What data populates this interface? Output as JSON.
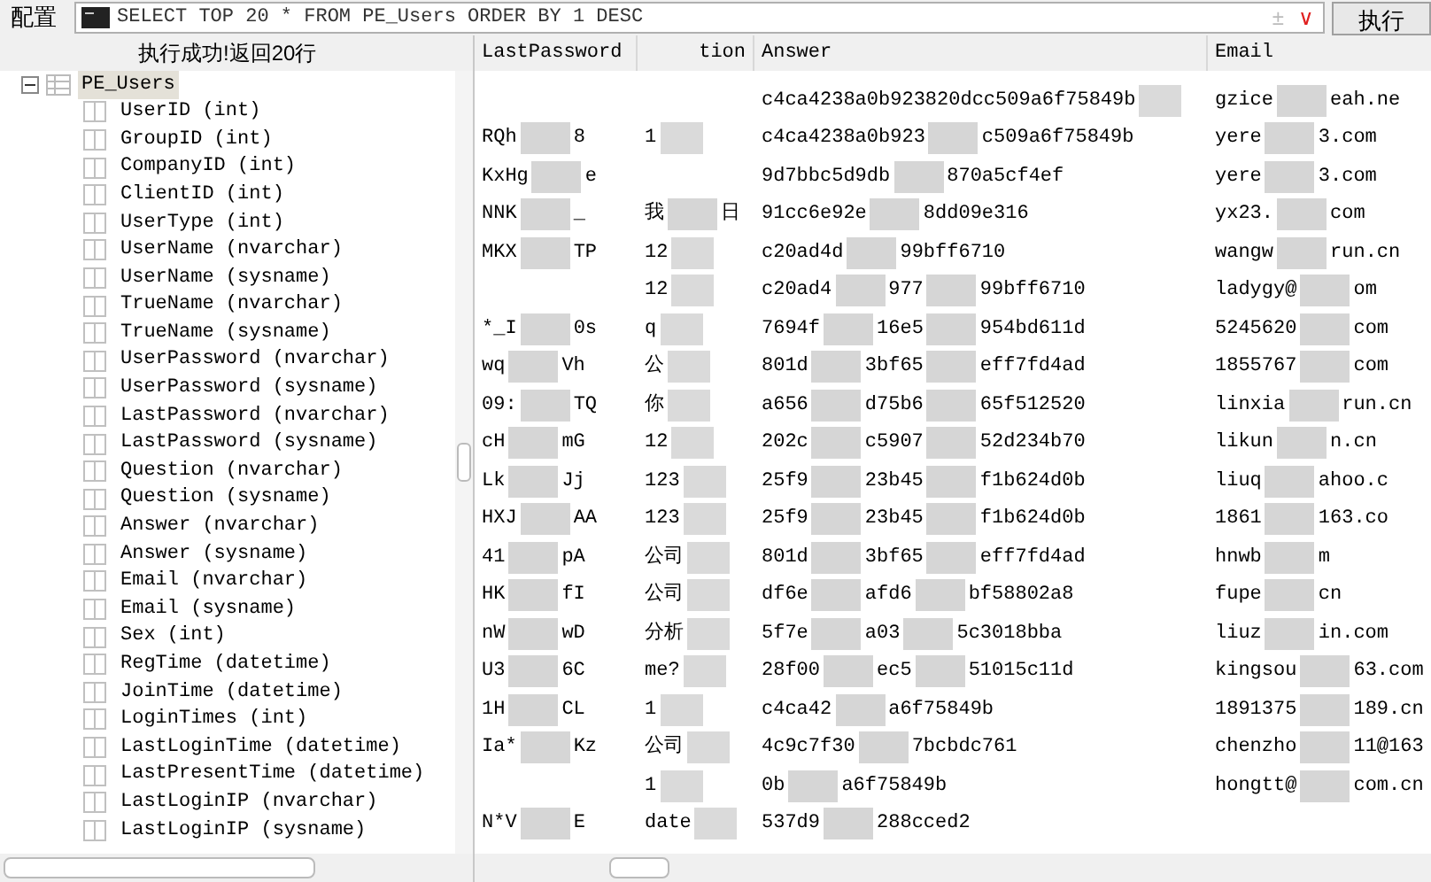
{
  "toolbar": {
    "config_label": "配置",
    "sql": "SELECT TOP 20 * FROM PE_Users ORDER BY 1 DESC",
    "plus_minus": "±",
    "dropdown": "∨",
    "execute": "执行"
  },
  "status": "执行成功!返回20行",
  "tree": {
    "table": "PE_Users",
    "selected": true,
    "expanded": true,
    "children": [
      {
        "label": "UserID (int)"
      },
      {
        "label": "GroupID (int)"
      },
      {
        "label": "CompanyID (int)"
      },
      {
        "label": "ClientID (int)"
      },
      {
        "label": "UserType (int)"
      },
      {
        "label": "UserName (nvarchar)"
      },
      {
        "label": "UserName (sysname)"
      },
      {
        "label": "TrueName (nvarchar)"
      },
      {
        "label": "TrueName (sysname)"
      },
      {
        "label": "UserPassword (nvarchar)"
      },
      {
        "label": "UserPassword (sysname)"
      },
      {
        "label": "LastPassword (nvarchar)"
      },
      {
        "label": "LastPassword (sysname)"
      },
      {
        "label": "Question (nvarchar)"
      },
      {
        "label": "Question (sysname)"
      },
      {
        "label": "Answer (nvarchar)"
      },
      {
        "label": "Answer (sysname)"
      },
      {
        "label": "Email (nvarchar)"
      },
      {
        "label": "Email (sysname)"
      },
      {
        "label": "Sex (int)"
      },
      {
        "label": "RegTime (datetime)"
      },
      {
        "label": "JoinTime (datetime)"
      },
      {
        "label": "LoginTimes (int)"
      },
      {
        "label": "LastLoginTime (datetime)"
      },
      {
        "label": "LastPresentTime (datetime)"
      },
      {
        "label": "LastLoginIP (nvarchar)"
      },
      {
        "label": "LastLoginIP (sysname)"
      }
    ]
  },
  "table": {
    "columns": [
      "LastPassword",
      "tion",
      "Answer",
      "Email"
    ],
    "rows": [
      [
        [],
        [],
        [
          "c4ca4238a0b923820dcc509a6f75849b"
        ],
        [
          "gzice",
          "eah.ne"
        ]
      ],
      [
        [
          "RQh",
          "8"
        ],
        [
          "1"
        ],
        [
          "c4ca4238a0b923",
          "c509a6f75849b"
        ],
        [
          "yere",
          "3.com"
        ]
      ],
      [
        [
          "KxHg",
          "e"
        ],
        [],
        [
          "9d7bbc5d9db",
          "870a5cf4ef"
        ],
        [
          "yere",
          "3.com"
        ]
      ],
      [
        [
          "NNK",
          "_"
        ],
        [
          "我",
          "日"
        ],
        [
          "91cc6e92e",
          "8dd09e316"
        ],
        [
          "yx23.",
          "com"
        ]
      ],
      [
        [
          "MKX",
          "TP"
        ],
        [
          "12"
        ],
        [
          "c20ad4d",
          "99bff6710"
        ],
        [
          "wangw",
          "run.cn"
        ]
      ],
      [
        [],
        [
          "12"
        ],
        [
          "c20ad4",
          "977",
          "99bff6710"
        ],
        [
          "ladygy@",
          "om"
        ]
      ],
      [
        [
          "*_I",
          "0s"
        ],
        [
          "q"
        ],
        [
          "7694f",
          "16e5",
          "954bd611d"
        ],
        [
          "5245620",
          "com"
        ]
      ],
      [
        [
          "wq",
          "Vh"
        ],
        [
          "公"
        ],
        [
          "801d",
          "3bf65",
          "eff7fd4ad"
        ],
        [
          "1855767",
          "com"
        ]
      ],
      [
        [
          "09:",
          "TQ"
        ],
        [
          "你"
        ],
        [
          "a656",
          "d75b6",
          "65f512520"
        ],
        [
          "linxia",
          "run.cn"
        ]
      ],
      [
        [
          "cH",
          "mG"
        ],
        [
          "12"
        ],
        [
          "202c",
          "c5907",
          "52d234b70"
        ],
        [
          "likun",
          "n.cn"
        ]
      ],
      [
        [
          "Lk",
          "Jj"
        ],
        [
          "123"
        ],
        [
          "25f9",
          "23b45",
          "f1b624d0b"
        ],
        [
          "liuq",
          "ahoo.c"
        ]
      ],
      [
        [
          "HXJ",
          "AA"
        ],
        [
          "123"
        ],
        [
          "25f9",
          "23b45",
          "f1b624d0b"
        ],
        [
          "1861",
          "163.co"
        ]
      ],
      [
        [
          "41",
          "pA"
        ],
        [
          "公司"
        ],
        [
          "801d",
          "3bf65",
          "eff7fd4ad"
        ],
        [
          "hnwb",
          "m"
        ]
      ],
      [
        [
          "HK",
          "fI"
        ],
        [
          "公司"
        ],
        [
          "df6e",
          "afd6",
          "bf58802a8"
        ],
        [
          "fupe",
          "cn"
        ]
      ],
      [
        [
          "nW",
          "wD"
        ],
        [
          "分析"
        ],
        [
          "5f7e",
          "a03",
          "5c3018bba"
        ],
        [
          "liuz",
          "in.com"
        ]
      ],
      [
        [
          "U3",
          "6C"
        ],
        [
          "me?"
        ],
        [
          "28f00",
          "ec5",
          "51015c11d"
        ],
        [
          "kingsou",
          "63.com"
        ]
      ],
      [
        [
          "1H",
          "CL"
        ],
        [
          "1"
        ],
        [
          "c4ca42",
          "a6f75849b"
        ],
        [
          "1891375",
          "189.cn"
        ]
      ],
      [
        [
          "Ia*",
          "Kz"
        ],
        [
          "公司"
        ],
        [
          "4c9c7f30",
          "7bcbdc761"
        ],
        [
          "chenzho",
          "11@163"
        ]
      ],
      [
        [],
        [
          "1"
        ],
        [
          "0b",
          "a6f75849b"
        ],
        [
          "hongtt@",
          "com.cn"
        ]
      ],
      [
        [
          "N*V",
          "E"
        ],
        [
          "date"
        ],
        [
          "537d9",
          "288cced2"
        ],
        []
      ]
    ]
  }
}
